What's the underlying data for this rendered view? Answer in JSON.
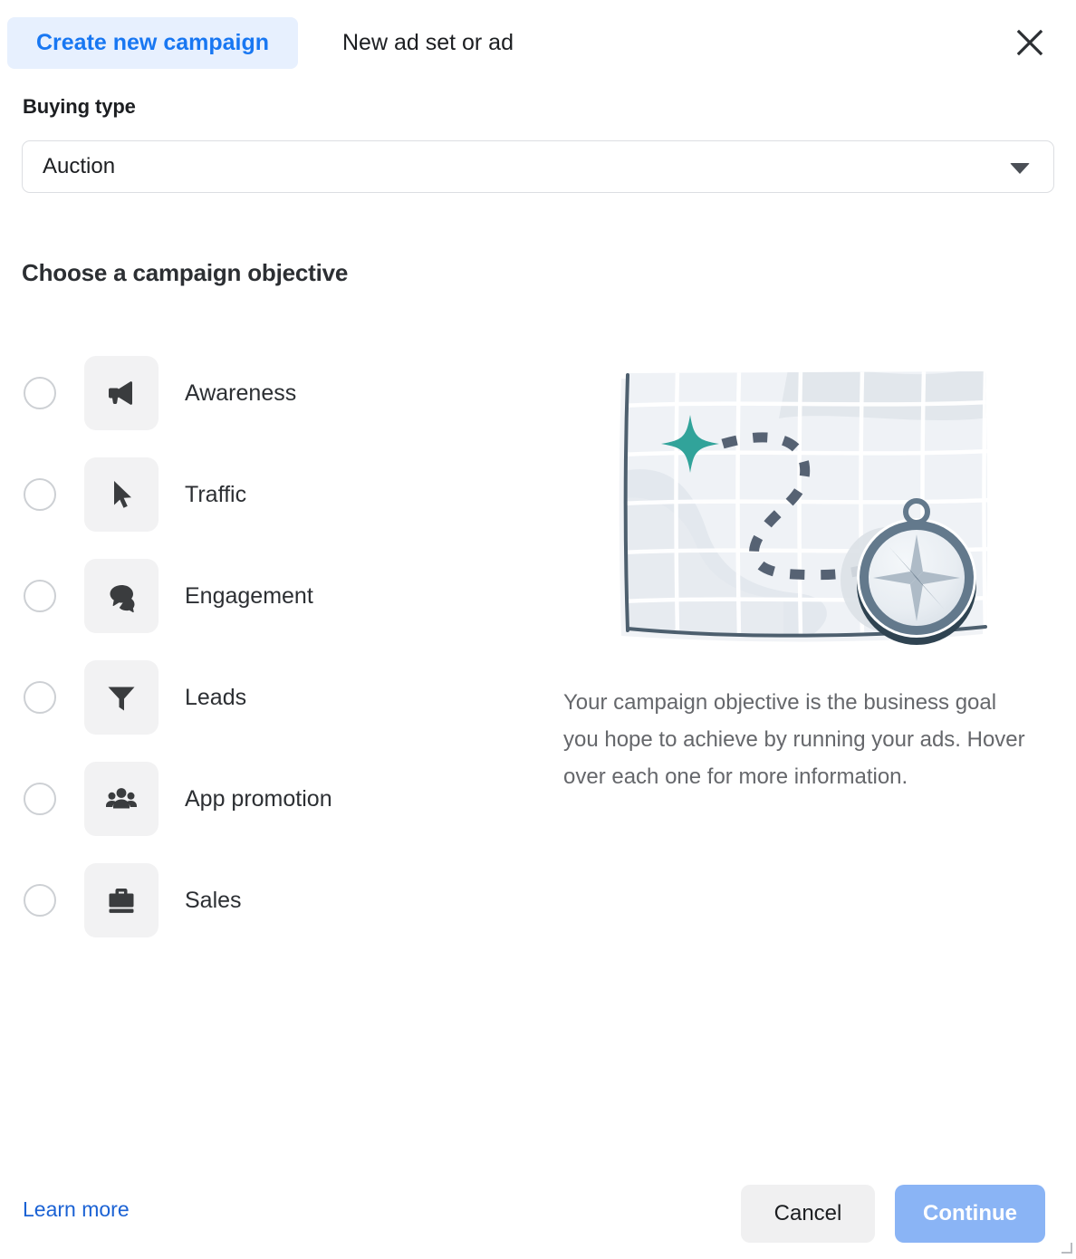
{
  "header": {
    "tabs": [
      {
        "label": "Create new campaign",
        "active": true
      },
      {
        "label": "New ad set or ad",
        "active": false
      }
    ],
    "close_icon": "close-icon"
  },
  "buying_type": {
    "label": "Buying type",
    "value": "Auction",
    "options": [
      "Auction"
    ],
    "arrow_icon": "chevron-down-icon"
  },
  "objective_section": {
    "title": "Choose a campaign objective",
    "items": [
      {
        "label": "Awareness",
        "icon": "megaphone-icon",
        "selected": false
      },
      {
        "label": "Traffic",
        "icon": "cursor-icon",
        "selected": false
      },
      {
        "label": "Engagement",
        "icon": "chat-bubbles-icon",
        "selected": false
      },
      {
        "label": "Leads",
        "icon": "funnel-icon",
        "selected": false
      },
      {
        "label": "App promotion",
        "icon": "people-icon",
        "selected": false
      },
      {
        "label": "Sales",
        "icon": "briefcase-icon",
        "selected": false
      }
    ]
  },
  "right_panel": {
    "illustration": "map-with-compass-illustration",
    "description": "Your campaign objective is the business goal you hope to achieve by running your ads. Hover over each one for more information."
  },
  "footer": {
    "learn_more": "Learn more",
    "cancel": "Cancel",
    "continue": "Continue"
  },
  "colors": {
    "accent_blue": "#1877f2",
    "tab_active_bg": "#e7f0fe",
    "link_blue": "#1b62d4",
    "continue_bg": "#8ab4f5",
    "cancel_bg": "#f0f0f1",
    "icon_tile_bg": "#f2f2f3",
    "star_teal": "#31a39a",
    "map_path": "#566273",
    "compass_dark": "#2f4351",
    "text_secondary": "#65676b"
  }
}
